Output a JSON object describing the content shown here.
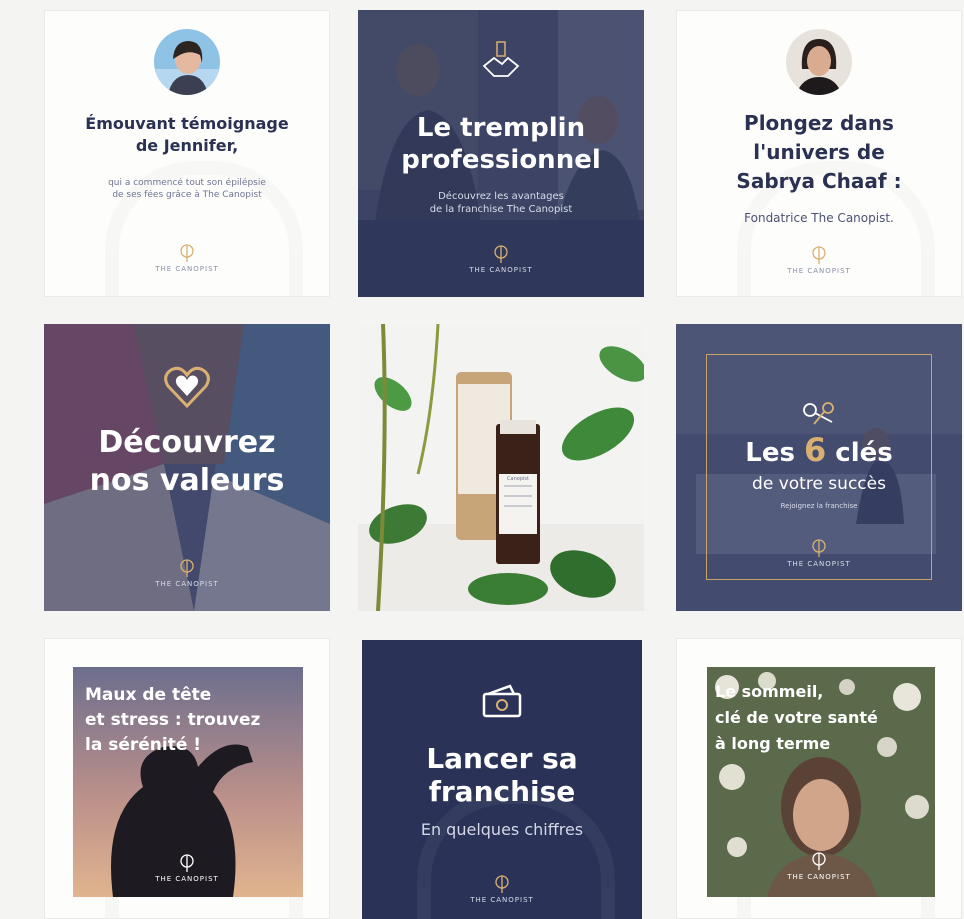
{
  "colors": {
    "navy": "#2b3153",
    "navy_overlay": "#323b62",
    "gold": "#d9b071",
    "background": "#f4f4f3"
  },
  "brand": {
    "logo_text": "THE CANOPIST"
  },
  "tiles": [
    {
      "title_line1": "Émouvant témoignage",
      "title_line2": "de Jennifer,",
      "subtitle_line1": "qui a commencé tout son épilépsie",
      "subtitle_line2": "de ses fées grâce à The Canopist"
    },
    {
      "title_line1": "Le tremplin",
      "title_line2": "professionnel",
      "subtitle_line1": "Découvrez les avantages",
      "subtitle_line2": "de la franchise The Canopist"
    },
    {
      "title_line1": "Plongez dans",
      "title_line2": "l'univers de",
      "title_line3": "Sabrya Chaaf :",
      "subtitle_line1": "Fondatrice The Canopist."
    },
    {
      "title_line1": "Découvrez",
      "title_line2": "nos valeurs"
    },
    {
      "product_label": "Canopist"
    },
    {
      "title_prefix": "Les ",
      "title_number": "6",
      "title_suffix": " clés",
      "title_line2": "de votre succès",
      "subtitle_line1": "Rejoignez la franchise"
    },
    {
      "title_line1": "Maux de tête",
      "title_line2": "et stress : trouvez",
      "title_line3": "la sérénité !"
    },
    {
      "title_line1": "Lancer sa",
      "title_line2": "franchise",
      "subtitle_line1": "En quelques chiffres"
    },
    {
      "title_line1": "Le sommeil,",
      "title_line2": "clé de votre santé",
      "title_line3": "à long terme"
    }
  ]
}
